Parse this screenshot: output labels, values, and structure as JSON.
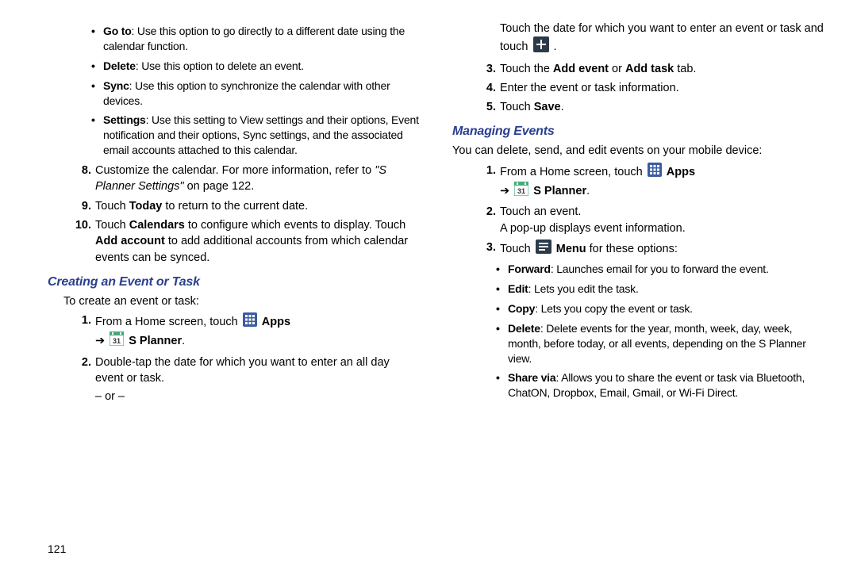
{
  "left": {
    "options": [
      {
        "term": "Go to",
        "desc": ": Use this option to go directly to a different date using the calendar function."
      },
      {
        "term": "Delete",
        "desc": ": Use this option to delete an event."
      },
      {
        "term": "Sync",
        "desc": ": Use this option to synchronize the calendar with other devices."
      },
      {
        "term": "Settings",
        "desc": ": Use this setting to View settings and their options, Event notification and their options, Sync settings, and the associated email accounts attached to this calendar."
      }
    ],
    "step8_a": "Customize the calendar. For more information, refer to ",
    "step8_b": "\"S Planner Settings\"",
    "step8_c": " on page 122.",
    "step9_a": "Touch ",
    "step9_b": "Today",
    "step9_c": " to return to the current date.",
    "step10_a": "Touch ",
    "step10_b": "Calendars",
    "step10_c": " to configure which events to display. Touch ",
    "step10_d": "Add account",
    "step10_e": " to add additional accounts from which calendar events can be synced.",
    "section1": "Creating an Event or Task",
    "section1_intro": "To create an event or task:",
    "s1_1_a": "From a Home screen, touch ",
    "apps_label": "Apps",
    "s1_1_arrow": "➔",
    "splanner_label": "S Planner",
    "s1_2": "Double-tap the date for which you want to enter an all day event or task.",
    "or": "– or –"
  },
  "right": {
    "s1_2b_a": "Touch the date for which you want to enter an event or task and touch ",
    "s1_2b_b": ".",
    "s1_3_a": "Touch the ",
    "s1_3_b": "Add event",
    "s1_3_c": " or ",
    "s1_3_d": "Add task",
    "s1_3_e": "  tab.",
    "s1_4": "Enter the event or task information.",
    "s1_5_a": "Touch ",
    "s1_5_b": "Save",
    "s1_5_c": ".",
    "section2": "Managing Events",
    "section2_intro": "You can delete, send, and edit events on your mobile device:",
    "m1_a": "From a Home screen, touch ",
    "m1_arrow": "➔",
    "m2": "Touch an event.",
    "m2b": "A pop-up displays event information.",
    "m3_a": "Touch ",
    "m3_menu": "Menu",
    "m3_b": " for these options:",
    "menu_options": [
      {
        "term": "Forward",
        "desc": ": Launches email for you to forward the event."
      },
      {
        "term": "Edit",
        "desc": ": Lets you edit the task."
      },
      {
        "term": "Copy",
        "desc": ": Lets you copy the event or task."
      },
      {
        "term": "Delete",
        "desc": ": Delete events for the year, month, week, day, week, month, before today, or all events, depending on the S Planner view."
      },
      {
        "term": "Share via",
        "desc": ": Allows you to share the event or task via Bluetooth, ChatON, Dropbox, Email, Gmail, or Wi-Fi Direct."
      }
    ]
  },
  "page_number": "121",
  "nums": {
    "n8": "8.",
    "n9": "9.",
    "n10": "10.",
    "n1": "1.",
    "n2": "2.",
    "n3": "3.",
    "n4": "4.",
    "n5": "5."
  }
}
